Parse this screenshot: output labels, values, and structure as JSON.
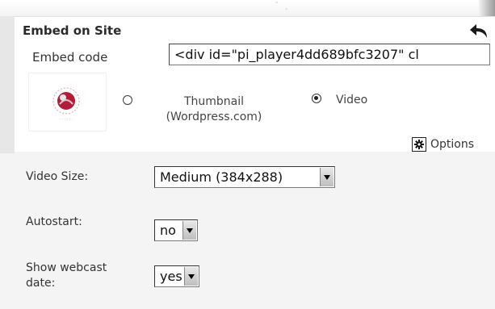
{
  "embed": {
    "title": "Embed on Site",
    "embed_code_label": "Embed code",
    "embed_code_value": "<div id=\"pi_player4dd689bfc3207\" cl",
    "thumbnail_label_line1": "Thumbnail",
    "thumbnail_label_line2": "(Wordpress.com)",
    "video_label": "Video",
    "selected": "video",
    "options_label": "Options"
  },
  "settings": {
    "video_size_label": "Video Size:",
    "video_size_value": "Medium (384x288)",
    "autostart_label": "Autostart:",
    "autostart_value": "no",
    "webcast_date_label_line1": "Show webcast",
    "webcast_date_label_line2": "date:",
    "webcast_date_value": "yes"
  },
  "icons": {
    "back": "back-arrow-icon",
    "options": "gear-icon",
    "logo": "council-logo"
  },
  "colors": {
    "logo_accent": "#b01f3a",
    "panel_bg": "#ffffff",
    "settings_bg": "#f4f4f4"
  }
}
